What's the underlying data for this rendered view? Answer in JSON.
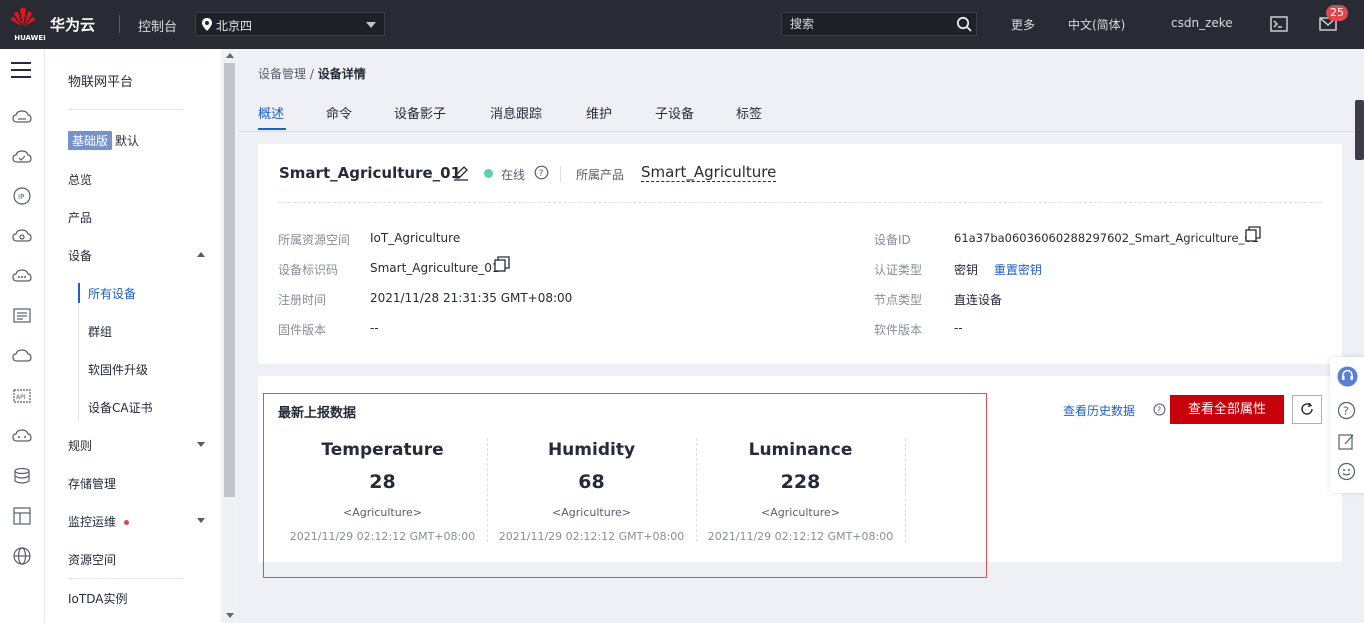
{
  "topbar": {
    "logo_text": "HUAWEI",
    "brand": "华为云",
    "console": "控制台",
    "region": "北京四",
    "search_placeholder": "搜索",
    "more": "更多",
    "language": "中文(简体)",
    "user": "csdn_zeke",
    "notifications": "25"
  },
  "sidebar": {
    "title": "物联网平台",
    "edition_tag": "基础版",
    "edition_label": "默认",
    "items": {
      "overview": "总览",
      "product": "产品",
      "device": "设备",
      "all_devices": "所有设备",
      "group": "群组",
      "firmware": "软固件升级",
      "ca": "设备CA证书",
      "rules": "规则",
      "storage": "存储管理",
      "monitor": "监控运维",
      "resource": "资源空间",
      "instance": "IoTDA实例"
    }
  },
  "breadcrumb": {
    "parent": "设备管理",
    "sep": " / ",
    "current": "设备详情"
  },
  "tabs": [
    "概述",
    "命令",
    "设备影子",
    "消息跟踪",
    "维护",
    "子设备",
    "标签"
  ],
  "device": {
    "name": "Smart_Agriculture_01",
    "status": "在线",
    "product_label": "所属产品",
    "product_value": "Smart_Agriculture",
    "fields_left": [
      {
        "label": "所属资源空间",
        "value": "IoT_Agriculture"
      },
      {
        "label": "设备标识码",
        "value": "Smart_Agriculture_01"
      },
      {
        "label": "注册时间",
        "value": "2021/11/28 21:31:35 GMT+08:00"
      },
      {
        "label": "固件版本",
        "value": "--"
      }
    ],
    "fields_right": [
      {
        "label": "设备ID",
        "value": "61a37ba06036060288297602_Smart_Agriculture_01"
      },
      {
        "label": "认证类型",
        "value": "密钥",
        "link": "重置密钥"
      },
      {
        "label": "节点类型",
        "value": "直连设备"
      },
      {
        "label": "软件版本",
        "value": "--"
      }
    ]
  },
  "latest": {
    "title": "最新上报数据",
    "history_link": "查看历史数据",
    "view_all_button": "查看全部属性",
    "metrics": [
      {
        "name": "Temperature",
        "value": "28",
        "service": "<Agriculture>",
        "time": "2021/11/29 02:12:12 GMT+08:00"
      },
      {
        "name": "Humidity",
        "value": "68",
        "service": "<Agriculture>",
        "time": "2021/11/29 02:12:12 GMT+08:00"
      },
      {
        "name": "Luminance",
        "value": "228",
        "service": "<Agriculture>",
        "time": "2021/11/29 02:12:12 GMT+08:00"
      }
    ]
  },
  "colors": {
    "accent": "#2060c0",
    "primary_button": "#c7000b",
    "online": "#5ecfae",
    "topbar": "#282b33"
  }
}
